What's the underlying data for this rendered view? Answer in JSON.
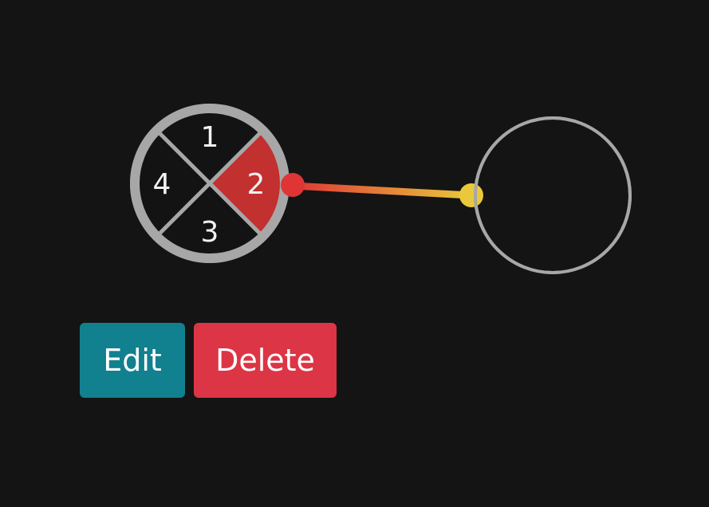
{
  "colors": {
    "background": "#141414",
    "ring": "#a7a7a7",
    "segment_dark": "#131313",
    "segment_active": "#c2302f",
    "segment_text": "#f2f2f2",
    "port_out": "#e03535",
    "port_in": "#e9c93b",
    "connector_start": "#e03535",
    "connector_end": "#e9c93b",
    "target_stroke": "#a7a7a7",
    "edit_button": "#11808f",
    "delete_button": "#dc3545"
  },
  "node": {
    "segments": [
      {
        "label": "1",
        "position": "top",
        "active": false
      },
      {
        "label": "2",
        "position": "right",
        "active": true
      },
      {
        "label": "3",
        "position": "bottom",
        "active": false
      },
      {
        "label": "4",
        "position": "left",
        "active": false
      }
    ],
    "ports": {
      "output_icon": "circle-dot-icon",
      "input_icon": "circle-dot-icon"
    }
  },
  "target_node": {
    "icon": "empty-circle-icon"
  },
  "buttons": {
    "edit_label": "Edit",
    "delete_label": "Delete"
  }
}
